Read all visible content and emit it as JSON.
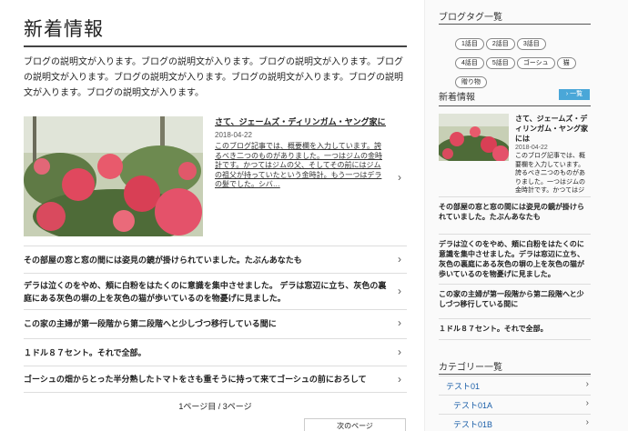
{
  "main": {
    "title": "新着情報",
    "intro": "ブログの説明文が入ります。ブログの説明文が入ります。ブログの説明文が入ります。ブログの説明文が入ります。ブログの説明文が入ります。ブログの説明文が入ります。ブログの説明文が入ります。ブログの説明文が入ります。",
    "featured": {
      "title": "さて、ジェームズ・ディリンガム・ヤング家には",
      "date": "2018-04-22",
      "excerpt": "このブログ記事では、概要欄を入力しています。誇るべき二つのものがありました。一つはジムの金時計です。かつてはジムの父、そしてその前にはジムの祖父が持っていたという金時計。もう一つはデラの髪でした。シバ…"
    },
    "items": [
      "その部屋の窓と窓の間には姿見の鏡が掛けられていました。たぶんあなたも",
      "デラは泣くのをやめ、頬に白粉をはたくのに意識を集中させました。 デラは窓辺に立ち、灰色の裏庭にある灰色の塀の上を灰色の猫が歩いているのを物憂げに見ました。",
      "この家の主婦が第一段階から第二段階へと少しづつ移行している間に",
      "１ドル８７セント。それで全部。",
      "ゴーシュの畑からとった半分熟したトマトをさも重そうに持って来てゴーシュの前におろして"
    ],
    "pager": "1ページ目 / 3ページ",
    "next": "次のページ",
    "chevron": "›"
  },
  "sidebar": {
    "tags_heading": "ブログタグ一覧",
    "tags": [
      "1話目",
      "2話目",
      "3話目",
      "4話目",
      "5話目",
      "ゴーシュ",
      "猫",
      "贈り物"
    ],
    "new_heading": "新着情報",
    "new_button": "› 一覧",
    "featured": {
      "title": "さて、ジェームズ・ディリンガム・ヤング家には",
      "date": "2018-04-22",
      "excerpt": "このブログ記事では、概要欄を入力しています。誇るべき二つのものがありました。一つはジムの金時計です。かつてはジムの…"
    },
    "items": [
      "その部屋の窓と窓の間には姿見の鏡が掛けられていました。たぶんあなたも",
      "デラは泣くのをやめ、頬に白粉をはたくのに意識を集中させました。デラは窓辺に立ち、灰色の裏庭にある灰色の塀の上を灰色の猫が歩いているのを物憂げに見ました。",
      "この家の主婦が第一段階から第二段階へと少しづつ移行している間に",
      "１ドル８７セント。それで全部。"
    ],
    "cat_heading": "カテゴリー一覧",
    "categories": [
      "テスト01",
      "テスト01A",
      "テスト01B"
    ]
  },
  "colors": {
    "accent": "#4aa7d8",
    "link": "#1a5ea8"
  }
}
